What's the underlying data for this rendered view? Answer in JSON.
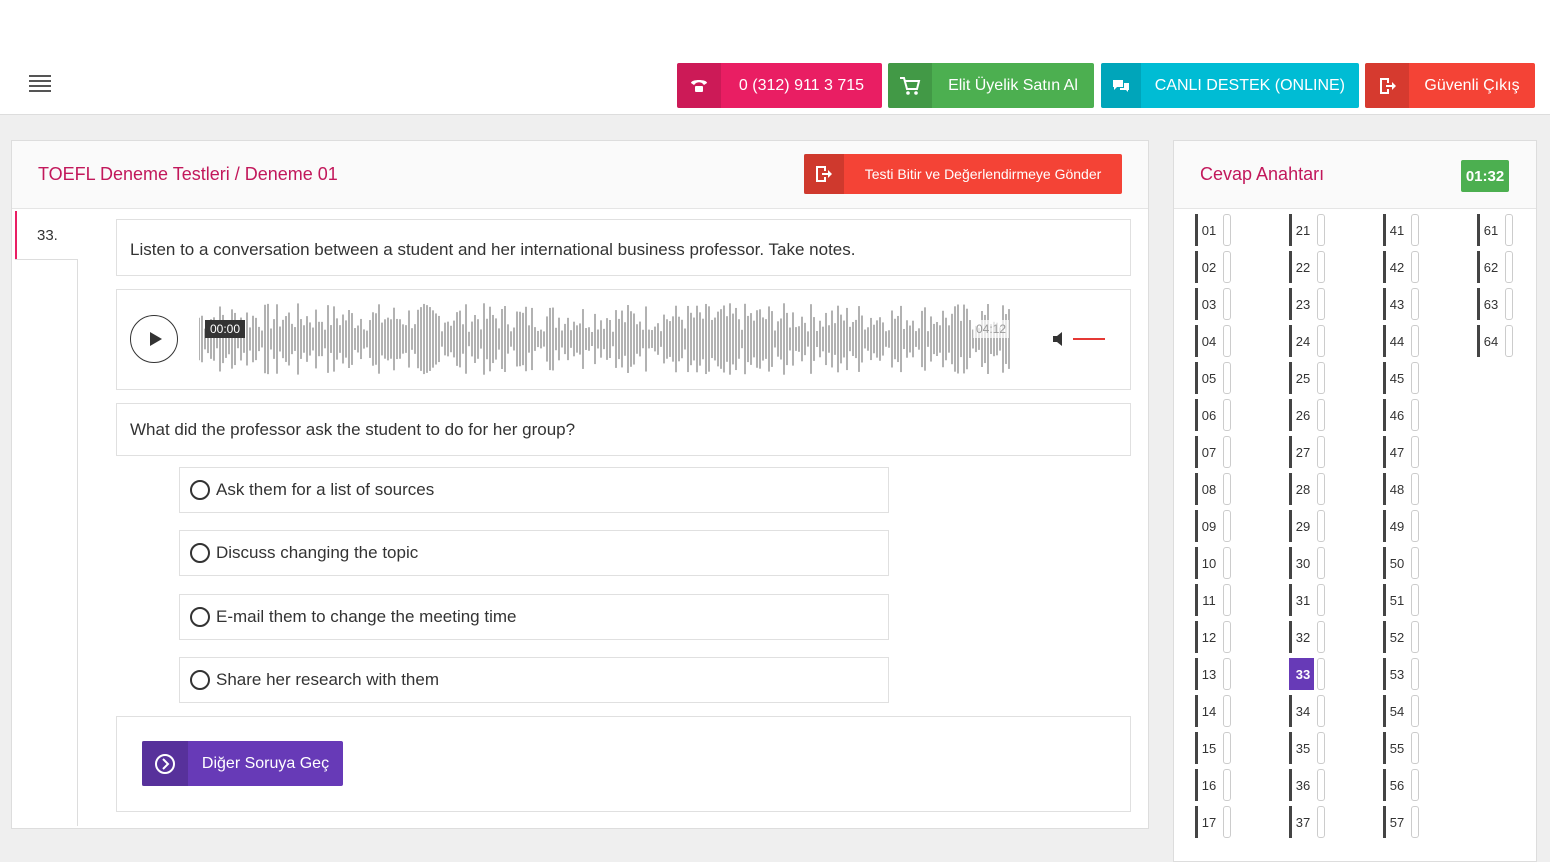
{
  "header": {
    "phone_label": "0 (312) 911 3 715",
    "membership_label": "Elit Üyelik Satın Al",
    "support_label": "CANLI DESTEK (ONLINE)",
    "logout_label": "Güvenli Çıkış"
  },
  "test": {
    "title": "TOEFL Deneme Testleri / Deneme 01",
    "finish_label": "Testi Bitir ve Değerlendirmeye Gönder",
    "question_number": "33.",
    "prompt": "Listen to a conversation between a student and her international business professor. Take notes.",
    "audio": {
      "current_time": "00:00",
      "duration": "04:12",
      "progress": 0
    },
    "question": "What did the professor ask the student to do for her group?",
    "options": [
      "Ask them for a list of sources",
      "Discuss changing the topic",
      "E-mail them to change the meeting time",
      "Share her research with them"
    ],
    "next_label": "Diğer Soruya Geç"
  },
  "answer_key": {
    "title": "Cevap Anahtarı",
    "timer": "01:32",
    "active": "33",
    "columns": [
      [
        "01",
        "02",
        "03",
        "04",
        "05",
        "06",
        "07",
        "08",
        "09",
        "10",
        "11",
        "12",
        "13",
        "14",
        "15",
        "16",
        "17"
      ],
      [
        "21",
        "22",
        "23",
        "24",
        "25",
        "26",
        "27",
        "28",
        "29",
        "30",
        "31",
        "32",
        "33",
        "34",
        "35",
        "36",
        "37"
      ],
      [
        "41",
        "42",
        "43",
        "44",
        "45",
        "46",
        "47",
        "48",
        "49",
        "50",
        "51",
        "52",
        "53",
        "54",
        "55",
        "56",
        "57"
      ],
      [
        "61",
        "62",
        "63",
        "64"
      ]
    ]
  },
  "colors": {
    "accent": "#c2185b",
    "phone": "#e91e63",
    "membership": "#4caf50",
    "support": "#00bcd4",
    "logout": "#f44336",
    "primary": "#673ab7"
  }
}
